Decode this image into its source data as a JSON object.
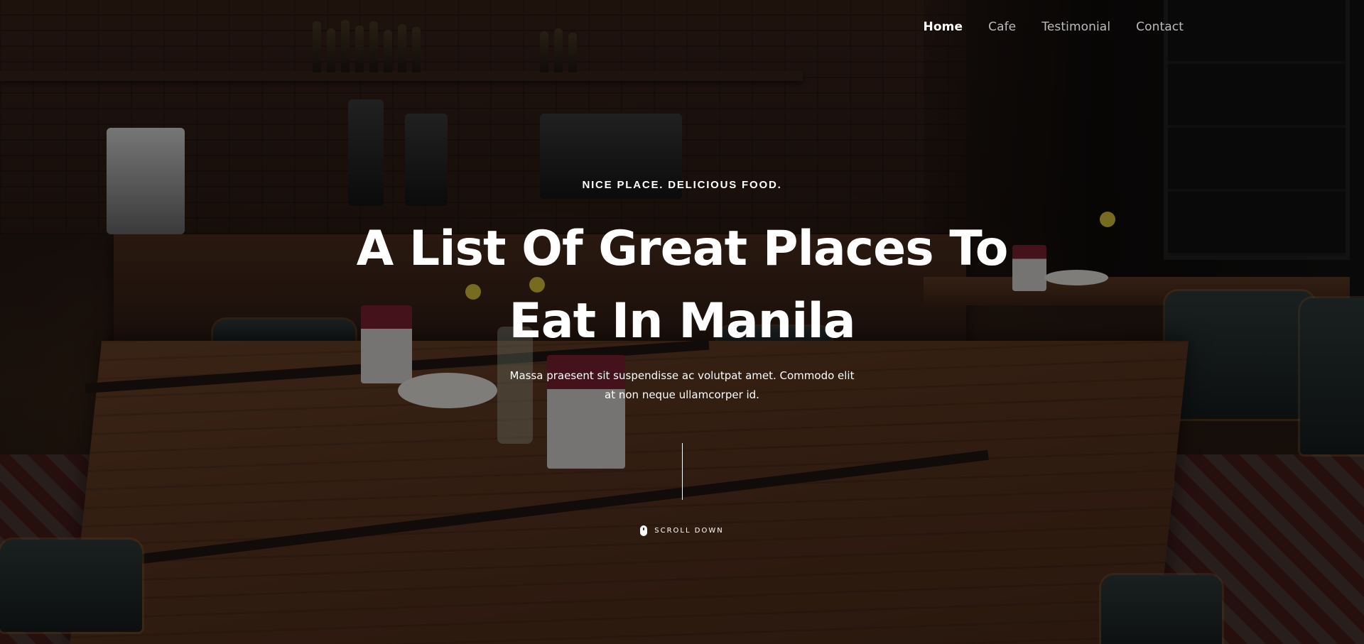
{
  "nav": {
    "items": [
      {
        "label": "Home",
        "active": true
      },
      {
        "label": "Cafe",
        "active": false
      },
      {
        "label": "Testimonial",
        "active": false
      },
      {
        "label": "Contact",
        "active": false
      }
    ]
  },
  "hero": {
    "tagline": "NICE PLACE. DELICIOUS FOOD.",
    "headline_line1": "A List Of Great Places To",
    "headline_line2": "Eat In Manila",
    "subtext_line1": "Massa praesent sit suspendisse ac volutpat amet. Commodo elit",
    "subtext_line2": "at non neque ullamcorper id.",
    "scroll_label": "SCROLL DOWN",
    "scroll_icon": "mouse-icon"
  },
  "colors": {
    "text": "#ffffff",
    "nav_inactive": "rgba(255,255,255,0.72)",
    "overlay": "rgba(0,0,0,0.45)"
  }
}
